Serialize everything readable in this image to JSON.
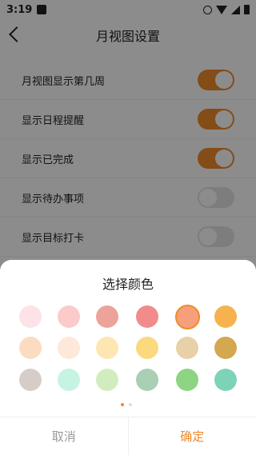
{
  "status_bar": {
    "time": "3:19",
    "icons": [
      "notification-icon",
      "alarm-icon",
      "wifi-icon",
      "signal-icon",
      "battery-icon"
    ]
  },
  "header": {
    "title": "月视图设置",
    "back_icon": "back-arrow-icon"
  },
  "settings": [
    {
      "label": "月视图显示第几周",
      "on": true
    },
    {
      "label": "显示日程提醒",
      "on": true
    },
    {
      "label": "显示已完成",
      "on": true
    },
    {
      "label": "显示待办事项",
      "on": false
    },
    {
      "label": "显示目标打卡",
      "on": false
    }
  ],
  "color_picker": {
    "title": "选择颜色",
    "selected_index": 4,
    "colors": [
      "#fde2e8",
      "#fbcaca",
      "#eca39a",
      "#f28b8c",
      "#f6a07b",
      "#f5b24e",
      "#fcdcc0",
      "#fde8d9",
      "#fde6b2",
      "#fbd97c",
      "#e8d0a8",
      "#d4a850",
      "#d6cdc8",
      "#c6f3e2",
      "#d1edc0",
      "#a9cfb4",
      "#8dd483",
      "#7dd3b8"
    ],
    "page_indicator": {
      "pages": 2,
      "current": 1
    },
    "cancel_label": "取消",
    "confirm_label": "确定"
  },
  "colors": {
    "accent": "#f08a2b"
  }
}
